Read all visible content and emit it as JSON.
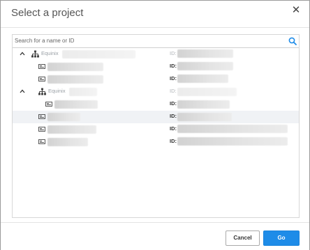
{
  "dialog": {
    "title": "Select a project",
    "close_icon": "close-icon"
  },
  "search": {
    "placeholder": "Search for a name or ID",
    "value": "",
    "icon": "search-icon"
  },
  "tree": {
    "id_label": "ID:",
    "rows": [
      {
        "type": "org",
        "name": "Equinix",
        "expanded": true,
        "muted": true
      },
      {
        "type": "project",
        "depth": 1
      },
      {
        "type": "project",
        "depth": 1
      },
      {
        "type": "org",
        "name": "Equinix",
        "expanded": true,
        "muted": true
      },
      {
        "type": "project",
        "depth": 2
      },
      {
        "type": "project",
        "depth": 1,
        "highlighted": true
      },
      {
        "type": "project",
        "depth": 1
      },
      {
        "type": "project",
        "depth": 1
      }
    ]
  },
  "footer": {
    "cancel_label": "Cancel",
    "go_label": "Go"
  },
  "colors": {
    "primary": "#1e8ce8",
    "row_highlight": "#f0f2f5",
    "search_icon": "#1e8ce8"
  }
}
